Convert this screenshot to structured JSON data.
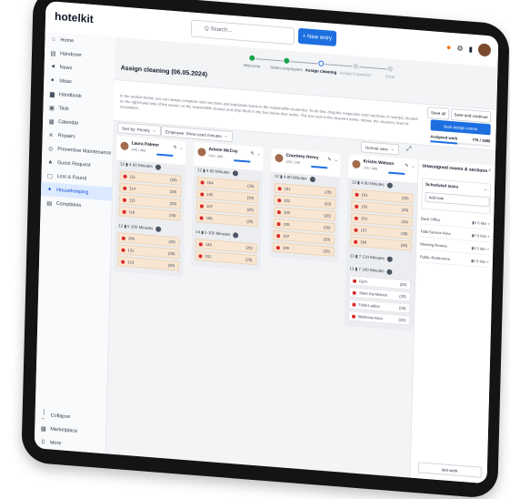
{
  "app": {
    "logo": "hotelkit"
  },
  "topbar": {
    "search_placeholder": "Q  Search...",
    "new_entry": "+ New entry"
  },
  "sidebar": {
    "items": [
      {
        "label": "Home",
        "icon": "home-icon",
        "glyph": "⌂"
      },
      {
        "label": "Handover",
        "icon": "handover-icon",
        "glyph": "▤"
      },
      {
        "label": "News",
        "icon": "megaphone-icon",
        "glyph": "◄"
      },
      {
        "label": "Ideas",
        "icon": "lightbulb-icon",
        "glyph": "●"
      },
      {
        "label": "Handbook",
        "icon": "book-icon",
        "glyph": "▆"
      },
      {
        "label": "Task",
        "icon": "task-icon",
        "glyph": "▣"
      },
      {
        "label": "Calendar",
        "icon": "calendar-icon",
        "glyph": "▦"
      },
      {
        "label": "Repairs",
        "icon": "tools-icon",
        "glyph": "✕"
      },
      {
        "label": "Preventive Maintenance",
        "icon": "maintenance-icon",
        "glyph": "⊙"
      },
      {
        "label": "Guest Request",
        "icon": "bell-icon",
        "glyph": "▲"
      },
      {
        "label": "Lost & Found",
        "icon": "box-icon",
        "glyph": "▢"
      },
      {
        "label": "Housekeeping",
        "icon": "broom-icon",
        "glyph": "♦",
        "active": true
      },
      {
        "label": "Complaints",
        "icon": "complaints-icon",
        "glyph": "▤"
      }
    ],
    "bottom": [
      {
        "label": "Collapse",
        "icon": "collapse-icon",
        "glyph": "|←"
      },
      {
        "label": "Marketplace",
        "icon": "marketplace-icon",
        "glyph": "▦"
      },
      {
        "label": "More",
        "icon": "more-icon",
        "glyph": "⠿"
      }
    ]
  },
  "stepper": {
    "steps": [
      "Welcome",
      "Select employees",
      "Assign cleaning",
      "Assign inspection",
      "Done"
    ]
  },
  "page": {
    "title": "Assign cleaning (06.05.2024)",
    "description": "In the section below, you can assign complete room sections and individual rooms to the responsible cleaner(s). To do this, drag the respective room sections or room(s), located on the right-hand side of the screen, to the responsible cleaner and drop them in the box below their name. The bar next to the cleaners name, shows, the cleaners, level of occupation.",
    "save_all": "Save all",
    "save_continue": "Save and continue",
    "auto_assign": "Auto assign rooms",
    "assigned_work_label": "Assigned work",
    "assigned_work_value": "776 / 1680",
    "assigned_work_fraction": 0.46
  },
  "filters": {
    "sort": "Sort by: Priority",
    "employee": "Employee: Show used minutes",
    "view": "Normal view"
  },
  "columns": [
    {
      "name": "Laura Palmer",
      "sub": "240 / 480",
      "groups": [
        {
          "header": "12  ▮ 4  60 Minutes",
          "rooms": [
            [
              "111",
              "(20)"
            ],
            [
              "114",
              "(20)"
            ],
            [
              "115",
              "(20)"
            ],
            [
              "116",
              "(20)"
            ]
          ]
        },
        {
          "header": "12  ▮ 5  100 Minutes",
          "rooms": [
            [
              "106",
              "(20)"
            ],
            [
              "131",
              "(20)"
            ],
            [
              "123",
              "(20)"
            ]
          ]
        }
      ]
    },
    {
      "name": "Arlene McCoy",
      "sub": "240 / 480",
      "groups": [
        {
          "header": "12  ▮ 4  80 Minutes",
          "rooms": [
            [
              "104",
              "(20)"
            ],
            [
              "105",
              "(20)"
            ],
            [
              "107",
              "(20)"
            ],
            [
              "108",
              "(20)"
            ]
          ]
        },
        {
          "header": "14  ▮ 5  100 Minutes",
          "rooms": [
            [
              "140",
              "(20)"
            ],
            [
              "152",
              "(20)"
            ]
          ]
        }
      ]
    },
    {
      "name": "Courtney Henry",
      "sub": "100 / 240",
      "groups": [
        {
          "header": "12  ▮ 4  80 Minutes",
          "rooms": [
            [
              "101",
              "(20)"
            ],
            [
              "102",
              "(20)"
            ],
            [
              "103",
              "(20)"
            ],
            [
              "105",
              "(20)"
            ],
            [
              "107",
              "(20)"
            ],
            [
              "109",
              "(20)"
            ]
          ]
        }
      ]
    },
    {
      "name": "Kristin Watson",
      "sub": "176 / 480",
      "groups": [
        {
          "header": "13  ▮ 4  80 Minutes",
          "rooms": [
            [
              "151",
              "(20)"
            ],
            [
              "152",
              "(20)"
            ],
            [
              "153",
              "(20)"
            ],
            [
              "157",
              "(20)"
            ],
            [
              "160",
              "(20)"
            ]
          ]
        },
        {
          "header": "13  ▮ 7  120 Minutes",
          "rooms": []
        },
        {
          "header": "13  ▮ 7  100 Minutes",
          "rooms": [
            [
              "Gym",
              "(20)"
            ],
            [
              "Toilet Gentlemen",
              "(20)"
            ],
            [
              "Toilet Ladies",
              "(20)"
            ],
            [
              "Wellness Area",
              "(20)"
            ]
          ]
        }
      ]
    }
  ],
  "unassigned": {
    "title": "Unassigned rooms & sections",
    "scheduled_tasks": "Scheduled tasks",
    "add_task": "Add task",
    "rows": [
      {
        "name": "Back Office",
        "meta": "▮0  0 Min  +"
      },
      {
        "name": "F&B Service Area",
        "meta": "▮0  0 Min  +"
      },
      {
        "name": "Meeting Rooms",
        "meta": "▮0  0 Min  +"
      },
      {
        "name": "Public Restrooms",
        "meta": "▮0  0 Min  +"
      }
    ],
    "last_work": "last work"
  },
  "colors": {
    "primary": "#1d6fe0",
    "room_card": "#f8e6d2",
    "room_dot": "#dc2626",
    "active_nav": "#dbeafe"
  }
}
